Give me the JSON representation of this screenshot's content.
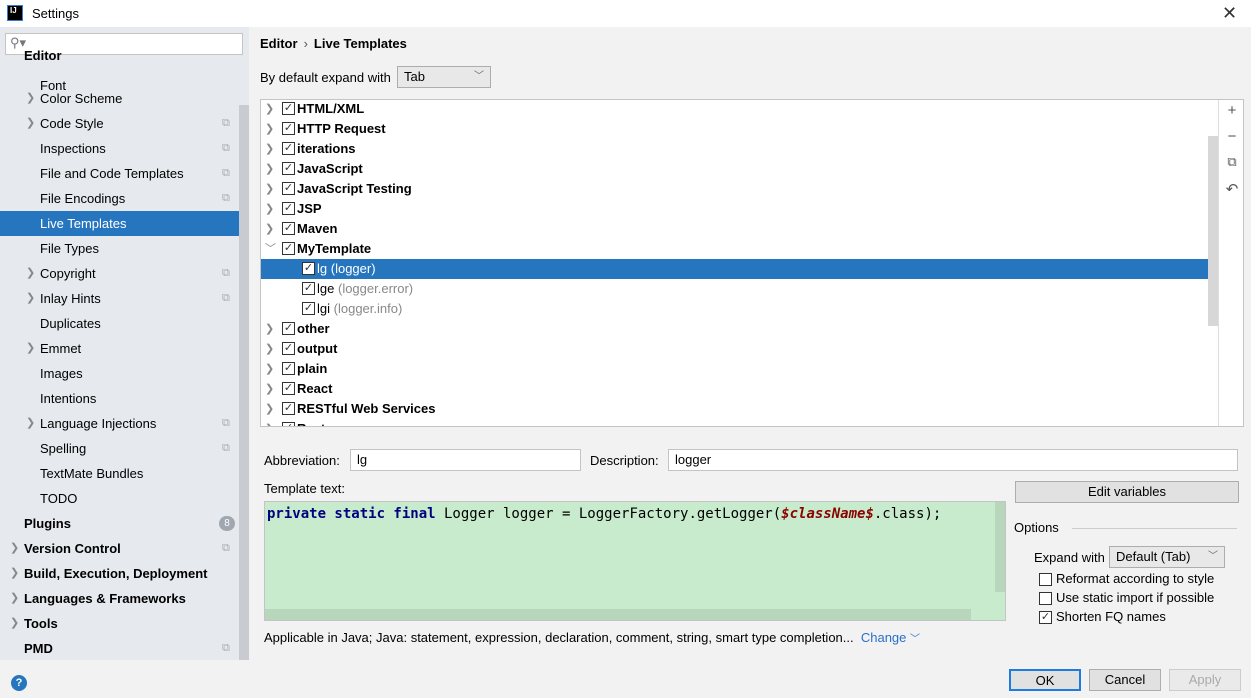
{
  "window": {
    "title": "Settings",
    "app_icon": "IJ"
  },
  "sidebar": {
    "search_placeholder": "",
    "items": [
      {
        "label": "Editor",
        "level": 0,
        "expandable": false
      },
      {
        "label": "Font",
        "level": 1
      },
      {
        "label": "Color Scheme",
        "level": 1,
        "expandable": true
      },
      {
        "label": "Code Style",
        "level": 1,
        "expandable": true,
        "project": true
      },
      {
        "label": "Inspections",
        "level": 1,
        "project": true
      },
      {
        "label": "File and Code Templates",
        "level": 1,
        "project": true
      },
      {
        "label": "File Encodings",
        "level": 1,
        "project": true
      },
      {
        "label": "Live Templates",
        "level": 1,
        "selected": true
      },
      {
        "label": "File Types",
        "level": 1
      },
      {
        "label": "Copyright",
        "level": 1,
        "expandable": true,
        "project": true
      },
      {
        "label": "Inlay Hints",
        "level": 1,
        "expandable": true,
        "project": true
      },
      {
        "label": "Duplicates",
        "level": 1
      },
      {
        "label": "Emmet",
        "level": 1,
        "expandable": true
      },
      {
        "label": "Images",
        "level": 1
      },
      {
        "label": "Intentions",
        "level": 1
      },
      {
        "label": "Language Injections",
        "level": 1,
        "expandable": true,
        "project": true
      },
      {
        "label": "Spelling",
        "level": 1,
        "project": true
      },
      {
        "label": "TextMate Bundles",
        "level": 1
      },
      {
        "label": "TODO",
        "level": 1
      },
      {
        "label": "Plugins",
        "level": 0,
        "badge": "8"
      },
      {
        "label": "Version Control",
        "level": 0,
        "expandable": true,
        "project": true
      },
      {
        "label": "Build, Execution, Deployment",
        "level": 0,
        "expandable": true
      },
      {
        "label": "Languages & Frameworks",
        "level": 0,
        "expandable": true
      },
      {
        "label": "Tools",
        "level": 0,
        "expandable": true
      },
      {
        "label": "PMD",
        "level": 0,
        "project": true
      }
    ]
  },
  "breadcrumb": {
    "parent": "Editor",
    "current": "Live Templates"
  },
  "expand": {
    "label": "By default expand with",
    "value": "Tab"
  },
  "tree": {
    "rows": [
      {
        "name": "HTML/XML",
        "checked": true
      },
      {
        "name": "HTTP Request",
        "checked": true
      },
      {
        "name": "iterations",
        "checked": true
      },
      {
        "name": "JavaScript",
        "checked": true
      },
      {
        "name": "JavaScript Testing",
        "checked": true
      },
      {
        "name": "JSP",
        "checked": true
      },
      {
        "name": "Maven",
        "checked": true
      },
      {
        "name": "MyTemplate",
        "checked": true,
        "expanded": true
      },
      {
        "name": "lg",
        "desc": "(logger)",
        "child": true,
        "checked": true,
        "selected": true
      },
      {
        "name": "lge",
        "desc": "(logger.error)",
        "child": true,
        "checked": true
      },
      {
        "name": "lgi",
        "desc": "(logger.info)",
        "child": true,
        "checked": true
      },
      {
        "name": "other",
        "checked": true
      },
      {
        "name": "output",
        "checked": true
      },
      {
        "name": "plain",
        "checked": true
      },
      {
        "name": "React",
        "checked": true
      },
      {
        "name": "RESTful Web Services",
        "checked": true
      },
      {
        "name": "Rest",
        "checked": true
      }
    ]
  },
  "toolbar": {
    "add": "+",
    "remove": "−",
    "copy": "⧉",
    "restore": "↶"
  },
  "form": {
    "abbreviation_label": "Abbreviation:",
    "abbreviation": "lg",
    "description_label": "Description:",
    "description": "logger",
    "template_label": "Template text:",
    "code": {
      "kw1": "private static final",
      "p1": " Logger logger = LoggerFactory.getLogger(",
      "var": "$className$",
      "p2": ".class);"
    },
    "applicable": "Applicable in Java; Java: statement, expression, declaration, comment, string, smart type completion...",
    "change": "Change"
  },
  "options": {
    "edit_variables": "Edit variables",
    "title": "Options",
    "expand_label": "Expand with",
    "expand_value": "Default (Tab)",
    "reformat": {
      "label": "Reformat according to style",
      "checked": false
    },
    "static_import": {
      "label": "Use static import if possible",
      "checked": false
    },
    "shorten": {
      "label": "Shorten FQ names",
      "checked": true
    }
  },
  "buttons": {
    "ok": "OK",
    "cancel": "Cancel",
    "apply": "Apply",
    "help": "?"
  }
}
